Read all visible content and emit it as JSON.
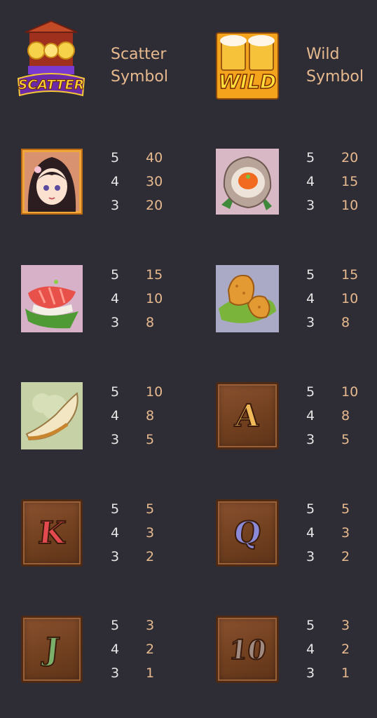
{
  "special": {
    "scatter": {
      "icon_text": "SCATTER",
      "label_line1": "Scatter",
      "label_line2": "Symbol"
    },
    "wild": {
      "icon_text": "WILD",
      "label_line1": "Wild",
      "label_line2": "Symbol"
    }
  },
  "symbols": {
    "girl": {
      "icon": "geisha-girl-icon",
      "pays": [
        [
          "5",
          "40"
        ],
        [
          "4",
          "30"
        ],
        [
          "3",
          "20"
        ]
      ]
    },
    "oyster": {
      "icon": "oyster-icon",
      "pays": [
        [
          "5",
          "20"
        ],
        [
          "4",
          "15"
        ],
        [
          "3",
          "10"
        ]
      ]
    },
    "sushi": {
      "icon": "tuna-sushi-icon",
      "pays": [
        [
          "5",
          "15"
        ],
        [
          "4",
          "10"
        ],
        [
          "3",
          "8"
        ]
      ]
    },
    "croquette": {
      "icon": "croquette-icon",
      "pays": [
        [
          "5",
          "15"
        ],
        [
          "4",
          "10"
        ],
        [
          "3",
          "8"
        ]
      ]
    },
    "gyoza": {
      "icon": "gyoza-icon",
      "pays": [
        [
          "5",
          "10"
        ],
        [
          "4",
          "8"
        ],
        [
          "3",
          "5"
        ]
      ]
    },
    "a": {
      "letter": "A",
      "color": "#f0b95a",
      "pays": [
        [
          "5",
          "10"
        ],
        [
          "4",
          "8"
        ],
        [
          "3",
          "5"
        ]
      ]
    },
    "k": {
      "letter": "K",
      "color": "#e24a4f",
      "pays": [
        [
          "5",
          "5"
        ],
        [
          "4",
          "3"
        ],
        [
          "3",
          "2"
        ]
      ]
    },
    "q": {
      "letter": "Q",
      "color": "#8a8ad8",
      "pays": [
        [
          "5",
          "5"
        ],
        [
          "4",
          "3"
        ],
        [
          "3",
          "2"
        ]
      ]
    },
    "j": {
      "letter": "J",
      "color": "#7ab06a",
      "pays": [
        [
          "5",
          "3"
        ],
        [
          "4",
          "2"
        ],
        [
          "3",
          "1"
        ]
      ]
    },
    "ten": {
      "letter": "10",
      "color": "#a08a80",
      "pays": [
        [
          "5",
          "3"
        ],
        [
          "4",
          "2"
        ],
        [
          "3",
          "1"
        ]
      ]
    }
  },
  "colors": {
    "background": "#2e2d35",
    "label": "#e7b98e",
    "count": "#e6e6e6"
  }
}
